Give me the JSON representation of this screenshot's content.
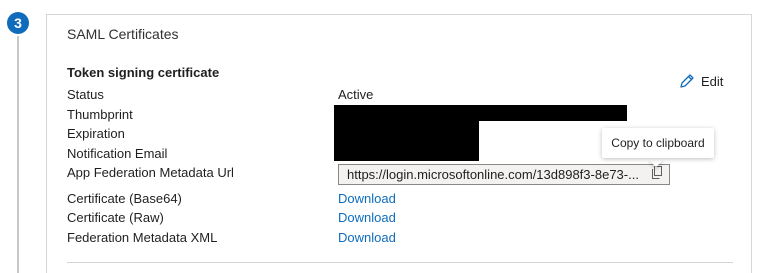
{
  "step": {
    "number": "3"
  },
  "section": {
    "title": "SAML Certificates",
    "subheading": "Token signing certificate",
    "edit_label": "Edit"
  },
  "fields": [
    {
      "label": "Status",
      "value": "Active"
    },
    {
      "label": "Thumbprint",
      "value": ""
    },
    {
      "label": "Expiration",
      "value": ""
    },
    {
      "label": "Notification Email",
      "value": ""
    },
    {
      "label": "App Federation Metadata Url",
      "value": "https://login.microsoftonline.com/13d898f3-8e73-..."
    },
    {
      "label": "Certificate (Base64)",
      "value": "Download"
    },
    {
      "label": "Certificate (Raw)",
      "value": "Download"
    },
    {
      "label": "Federation Metadata XML",
      "value": "Download"
    }
  ],
  "tooltip": {
    "text": "Copy to clipboard"
  },
  "colors": {
    "accent": "#0f6cbd",
    "link": "#0f6cbd",
    "redaction": "#000000"
  },
  "icons": {
    "edit": "pencil-icon",
    "copy": "copy-icon"
  }
}
